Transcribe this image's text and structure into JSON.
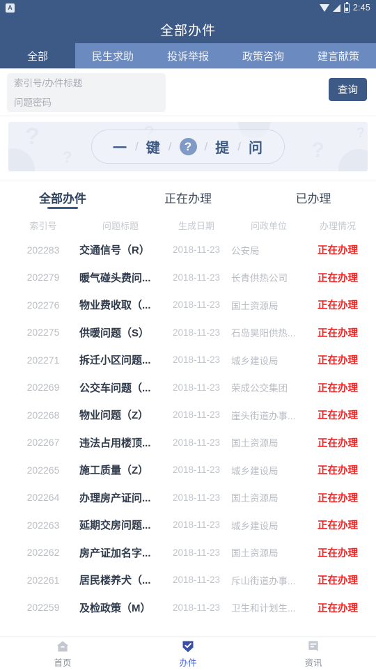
{
  "status_bar": {
    "app_icon": "A",
    "time": "2:45",
    "icons": [
      "wifi-icon",
      "signal-icon",
      "battery-icon"
    ]
  },
  "header": {
    "title": "全部办件"
  },
  "category_tabs": [
    {
      "label": "全部",
      "active": true
    },
    {
      "label": "民生求助",
      "active": false
    },
    {
      "label": "投诉举报",
      "active": false
    },
    {
      "label": "政策咨询",
      "active": false
    },
    {
      "label": "建言献策",
      "active": false
    }
  ],
  "search": {
    "keyword_placeholder": "索引号/办件标题",
    "keyword_value": "",
    "password_placeholder": "问题密码",
    "password_value": "",
    "query_button": "查询"
  },
  "banner": {
    "chars": [
      "一",
      "键",
      "提",
      "问"
    ],
    "separator": "/",
    "badge": "?",
    "watermark": "?"
  },
  "sub_tabs": [
    {
      "label": "全部办件",
      "active": true
    },
    {
      "label": "正在办理",
      "active": false
    },
    {
      "label": "已办理",
      "active": false
    }
  ],
  "table": {
    "columns": [
      "索引号",
      "问题标题",
      "生成日期",
      "问政单位",
      "办理情况"
    ],
    "rows": [
      {
        "index": "202283",
        "title": "交通信号（R）",
        "date": "2018-11-23",
        "unit": "公安局",
        "status": "正在办理"
      },
      {
        "index": "202279",
        "title": "暖气碰头费问...",
        "date": "2018-11-23",
        "unit": "长青供热公司",
        "status": "正在办理"
      },
      {
        "index": "202276",
        "title": "物业费收取（...",
        "date": "2018-11-23",
        "unit": "国土资源局",
        "status": "正在办理"
      },
      {
        "index": "202275",
        "title": "供暖问题（S）",
        "date": "2018-11-23",
        "unit": "石岛昊阳供热...",
        "status": "正在办理"
      },
      {
        "index": "202271",
        "title": "拆迁小区问题...",
        "date": "2018-11-23",
        "unit": "城乡建设局",
        "status": "正在办理"
      },
      {
        "index": "202269",
        "title": "公交车问题（...",
        "date": "2018-11-23",
        "unit": "荣成公交集团",
        "status": "正在办理"
      },
      {
        "index": "202268",
        "title": "物业问题（Z）",
        "date": "2018-11-23",
        "unit": "崖头街道办事...",
        "status": "正在办理"
      },
      {
        "index": "202267",
        "title": "违法占用楼顶...",
        "date": "2018-11-23",
        "unit": "国土资源局",
        "status": "正在办理"
      },
      {
        "index": "202265",
        "title": "施工质量（Z）",
        "date": "2018-11-23",
        "unit": "城乡建设局",
        "status": "正在办理"
      },
      {
        "index": "202264",
        "title": "办理房产证问...",
        "date": "2018-11-23",
        "unit": "国土资源局",
        "status": "正在办理"
      },
      {
        "index": "202263",
        "title": "延期交房问题...",
        "date": "2018-11-23",
        "unit": "城乡建设局",
        "status": "正在办理"
      },
      {
        "index": "202262",
        "title": "房产证加名字...",
        "date": "2018-11-23",
        "unit": "国土资源局",
        "status": "正在办理"
      },
      {
        "index": "202261",
        "title": "居民楼养犬（...",
        "date": "2018-11-23",
        "unit": "斥山街道办事...",
        "status": "正在办理"
      },
      {
        "index": "202259",
        "title": "及检政策（M）",
        "date": "2018-11-23",
        "unit": "卫生和计划生...",
        "status": "正在办理"
      }
    ]
  },
  "bottom_nav": [
    {
      "label": "首页",
      "icon": "home-icon",
      "active": false
    },
    {
      "label": "办件",
      "icon": "check-badge-icon",
      "active": true
    },
    {
      "label": "资讯",
      "icon": "news-icon",
      "active": false
    }
  ]
}
